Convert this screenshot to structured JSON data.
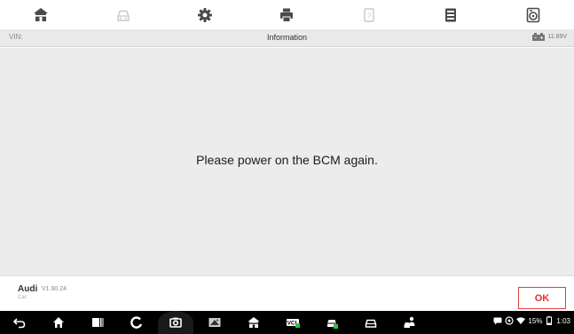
{
  "toolbar": {
    "items": [
      {
        "icon": "home-icon"
      },
      {
        "icon": "car-icon"
      },
      {
        "icon": "settings-icon"
      },
      {
        "icon": "print-icon"
      },
      {
        "icon": "help-icon"
      },
      {
        "icon": "save-icon"
      },
      {
        "icon": "data-icon"
      }
    ]
  },
  "infobar": {
    "vin_label": "VIN:",
    "title": "Information",
    "battery_voltage": "11.89V"
  },
  "main": {
    "message": "Please power on the BCM again."
  },
  "footer": {
    "make": "Audi",
    "version": "V1.90.24",
    "car_label": "Car:",
    "ok_label": "OK"
  },
  "statusbar": {
    "battery_percent": "15%",
    "time": "1:03"
  },
  "colors": {
    "accent": "#e03030",
    "background": "#ececec"
  }
}
